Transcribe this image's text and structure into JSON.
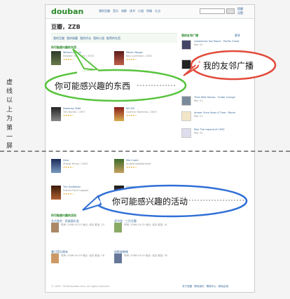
{
  "colors": {
    "green_accent": "#2b8a2b",
    "link_blue": "#336699",
    "bubble_green": "#58c33d",
    "bubble_red": "#e24a3b",
    "bubble_blue": "#2f6fd6"
  },
  "header": {
    "logo": "douban",
    "nav": [
      "我的豆瓣",
      "音乐",
      "电影",
      "读书",
      "小组",
      "同城",
      "九点"
    ],
    "user_links": [
      "提醒",
      "设置"
    ]
  },
  "page_title": "豆瓣，ZZB",
  "tabs": [
    "我的豆瓣",
    "我的收藏",
    "我的评论",
    "我的小组",
    "推荐的东西"
  ],
  "recommend": {
    "heading": "你可能感兴趣的东西",
    "items": [
      {
        "title": "Wicked (Music)",
        "meta": "Stephen Schwartz / 2003",
        "rating": "★★★★☆"
      },
      {
        "title": "Moulin Rouge",
        "meta": "Baz Luhrmann / 2001",
        "rating": "★★★★☆"
      },
      {
        "title": "Sweeney Todd",
        "meta": "Tim Burton / 2007",
        "rating": "★★★★☆"
      },
      {
        "title": "Kill Bill",
        "meta": "Quentin Tarantino / 2003",
        "rating": "★★★★☆"
      },
      {
        "title": "Hero",
        "meta": "Zhang Yimou / 2002",
        "rating": "★★★★☆"
      },
      {
        "title": "Mio Cuore",
        "meta": "Angelo Badalamenti",
        "rating": "★★★★☆"
      },
      {
        "title": "The Godfather",
        "meta": "Francis Ford Coppola",
        "rating": "★★★★☆"
      },
      {
        "title": "Chicago",
        "meta": "Rob Marshall / 2002",
        "rating": "★★★★☆"
      }
    ]
  },
  "friends": {
    "heading": "我的友邻广播",
    "more": "更多",
    "items": [
      {
        "name": "Lexwinmas",
        "text": "Vox Populi · Pacific Chant",
        "meta": "Mar 22"
      },
      {
        "name": "Aloe",
        "text": "Mondomotion · Lucky Star",
        "meta": "Mar 22"
      },
      {
        "name": "Thee",
        "text": "Wild Horses · Guitar Lounge",
        "meta": "Mar 21"
      },
      {
        "name": "Ameer",
        "text": "Once Upon A Time · Movie",
        "meta": "Mar 21"
      },
      {
        "name": "Kiko",
        "text": "The Legend of 1900",
        "meta": "Mar 20"
      }
    ]
  },
  "events": {
    "heading": "你可能感兴趣的活动",
    "items": [
      {
        "title": "东方鼓艺 · 民族鼓乐会",
        "text": "时间: 2008-04-15 地点: 北京 参加: 23"
      },
      {
        "title": "读书会 · 三月主题",
        "text": "时间: 2008-04-12 地点: 北京 参加: 41"
      },
      {
        "title": "春日音乐周末",
        "text": "时间: 2008-04-19 地点: 北京 参加: 18"
      },
      {
        "title": "电影放映夜",
        "text": "时间: 2008-04-20 地点: 北京 参加: 35"
      }
    ]
  },
  "footer": {
    "copyright": "© 2005－2008 douban.com, all rights reserved",
    "links": "关于豆瓣 · 联系我们 · 帮助中心 · 移动应用"
  },
  "annotations": {
    "left_vertical": "虚线以上为第一屏",
    "bubble_recommend": "你可能感兴趣的东西",
    "bubble_friends": "我的友邻广播",
    "bubble_events": "你可能感兴趣的活动"
  }
}
